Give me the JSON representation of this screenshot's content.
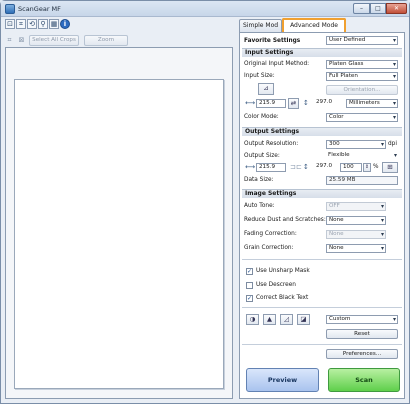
{
  "window": {
    "title": "ScanGear MF"
  },
  "left_toolbar": {
    "select_all_crops_label": "Select All Crops",
    "zoom_label": "Zoom"
  },
  "tabs": {
    "simple": "Simple Mod",
    "advanced": "Advanced Mode"
  },
  "favorite_settings": {
    "label": "Favorite Settings",
    "value": "User Defined"
  },
  "input_settings": {
    "header": "Input Settings",
    "original_input_method_label": "Original Input Method:",
    "original_input_method_value": "Platen Glass",
    "input_size_label": "Input Size:",
    "input_size_value": "Full Platen",
    "orientation_label": "Orientation...",
    "width_value": "215.9",
    "height_value": "297.0",
    "unit_value": "Millimeters",
    "color_mode_label": "Color Mode:",
    "color_mode_value": "Color"
  },
  "output_settings": {
    "header": "Output Settings",
    "output_resolution_label": "Output Resolution:",
    "output_resolution_value": "300",
    "dpi_label": "dpi",
    "output_size_label": "Output Size:",
    "output_size_value": "Flexible",
    "width_value": "215.9",
    "height_value": "297.0",
    "scale_value": "100",
    "percent_label": "%",
    "data_size_label": "Data Size:",
    "data_size_value": "25.59 MB"
  },
  "image_settings": {
    "header": "Image Settings",
    "auto_tone_label": "Auto Tone:",
    "auto_tone_value": "OFF",
    "reduce_dust_label": "Reduce Dust and Scratches:",
    "reduce_dust_value": "None",
    "fading_correction_label": "Fading Correction:",
    "fading_correction_value": "None",
    "grain_correction_label": "Grain Correction:",
    "grain_correction_value": "None",
    "unsharp_mask_label": "Use Unsharp Mask",
    "descreen_label": "Use Descreen",
    "correct_black_text_label": "Correct Black Text",
    "tone_preset_value": "Custom",
    "reset_label": "Reset"
  },
  "preferences_label": "Preferences...",
  "preview_label": "Preview",
  "scan_label": "Scan"
}
